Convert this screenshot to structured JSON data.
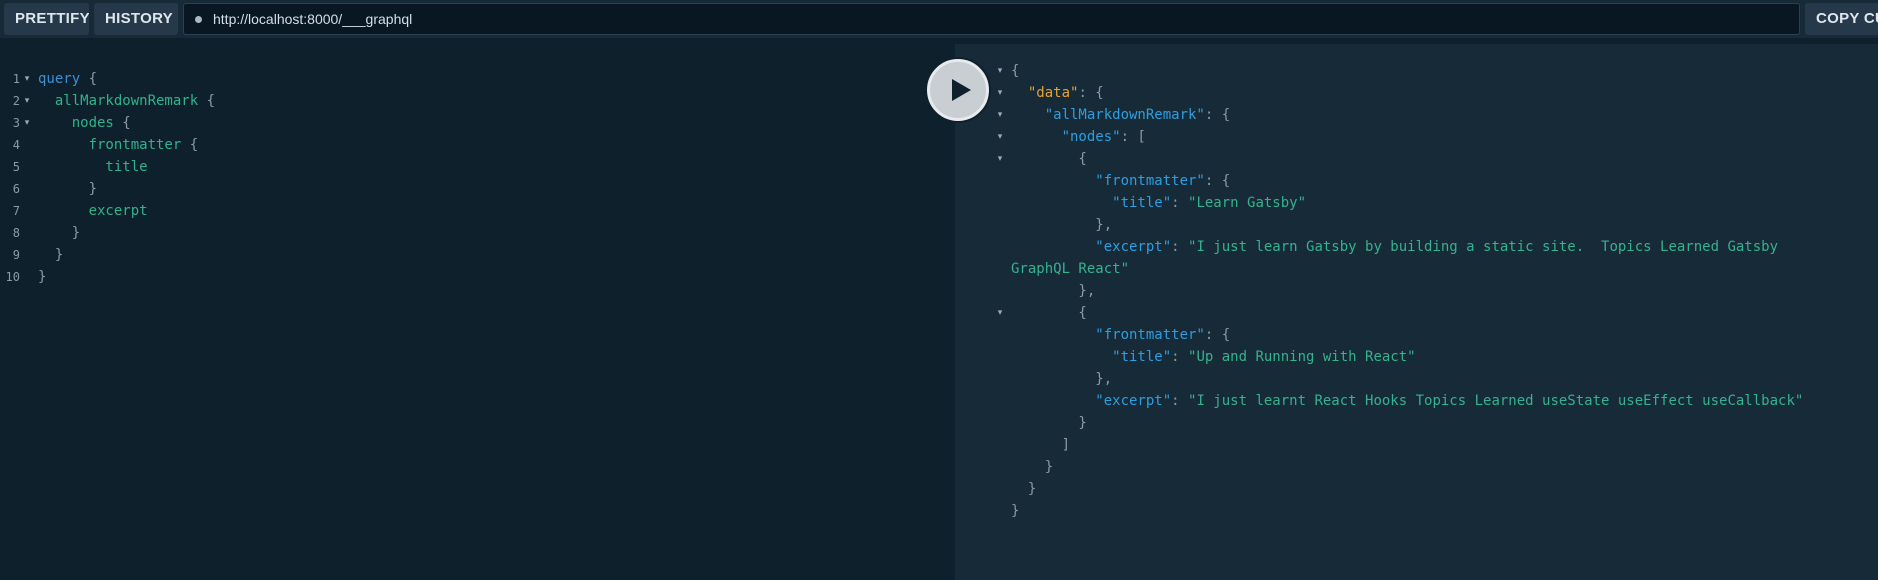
{
  "toolbar": {
    "prettify_label": "PRETTIFY",
    "history_label": "HISTORY",
    "url": "http://localhost:8000/___graphql",
    "copy_label": "COPY CU"
  },
  "run_button": {
    "icon": "play-icon"
  },
  "query_lines": [
    {
      "n": "1",
      "parts": [
        {
          "t": "query",
          "c": "kw"
        },
        {
          "t": " {",
          "c": "punc"
        }
      ]
    },
    {
      "n": "2",
      "parts": [
        {
          "t": "  allMarkdownRemark",
          "c": "field"
        },
        {
          "t": " {",
          "c": "punc"
        }
      ]
    },
    {
      "n": "3",
      "parts": [
        {
          "t": "    nodes",
          "c": "field"
        },
        {
          "t": " {",
          "c": "punc"
        }
      ]
    },
    {
      "n": "4",
      "parts": [
        {
          "t": "      frontmatter",
          "c": "field"
        },
        {
          "t": " {",
          "c": "punc"
        }
      ]
    },
    {
      "n": "5",
      "parts": [
        {
          "t": "        title",
          "c": "field"
        }
      ]
    },
    {
      "n": "6",
      "parts": [
        {
          "t": "      }",
          "c": "punc"
        }
      ]
    },
    {
      "n": "7",
      "parts": [
        {
          "t": "      excerpt",
          "c": "field"
        }
      ]
    },
    {
      "n": "8",
      "parts": [
        {
          "t": "    }",
          "c": "punc"
        }
      ]
    },
    {
      "n": "9",
      "parts": [
        {
          "t": "  }",
          "c": "punc"
        }
      ]
    },
    {
      "n": "10",
      "parts": [
        {
          "t": "}",
          "c": "punc"
        }
      ]
    }
  ],
  "result_lines": [
    {
      "parts": [
        {
          "t": "{",
          "c": "punc"
        }
      ]
    },
    {
      "parts": [
        {
          "t": "  \"data\"",
          "c": "dkey"
        },
        {
          "t": ": {",
          "c": "punc"
        }
      ]
    },
    {
      "parts": [
        {
          "t": "    \"allMarkdownRemark\"",
          "c": "key"
        },
        {
          "t": ": {",
          "c": "punc"
        }
      ]
    },
    {
      "parts": [
        {
          "t": "      \"nodes\"",
          "c": "key"
        },
        {
          "t": ": [",
          "c": "punc"
        }
      ]
    },
    {
      "parts": [
        {
          "t": "        {",
          "c": "punc"
        }
      ]
    },
    {
      "parts": [
        {
          "t": "          \"frontmatter\"",
          "c": "key"
        },
        {
          "t": ": {",
          "c": "punc"
        }
      ]
    },
    {
      "parts": [
        {
          "t": "            \"title\"",
          "c": "key"
        },
        {
          "t": ": ",
          "c": "punc"
        },
        {
          "t": "\"Learn Gatsby\"",
          "c": "str"
        }
      ]
    },
    {
      "parts": [
        {
          "t": "          },",
          "c": "punc"
        }
      ]
    },
    {
      "parts": [
        {
          "t": "          \"excerpt\"",
          "c": "key"
        },
        {
          "t": ": ",
          "c": "punc"
        },
        {
          "t": "\"I just learn Gatsby by building a static site.  Topics Learned Gatsby",
          "c": "str"
        }
      ]
    },
    {
      "parts": [
        {
          "t": "GraphQL React\"",
          "c": "str"
        }
      ]
    },
    {
      "parts": [
        {
          "t": "        },",
          "c": "punc"
        }
      ]
    },
    {
      "parts": [
        {
          "t": "        {",
          "c": "punc"
        }
      ]
    },
    {
      "parts": [
        {
          "t": "          \"frontmatter\"",
          "c": "key"
        },
        {
          "t": ": {",
          "c": "punc"
        }
      ]
    },
    {
      "parts": [
        {
          "t": "            \"title\"",
          "c": "key"
        },
        {
          "t": ": ",
          "c": "punc"
        },
        {
          "t": "\"Up and Running with React\"",
          "c": "str"
        }
      ]
    },
    {
      "parts": [
        {
          "t": "          },",
          "c": "punc"
        }
      ]
    },
    {
      "parts": [
        {
          "t": "          \"excerpt\"",
          "c": "key"
        },
        {
          "t": ": ",
          "c": "punc"
        },
        {
          "t": "\"I just learnt React Hooks Topics Learned useState useEffect useCallback\"",
          "c": "str"
        }
      ]
    },
    {
      "parts": [
        {
          "t": "        }",
          "c": "punc"
        }
      ]
    },
    {
      "parts": [
        {
          "t": "      ]",
          "c": "punc"
        }
      ]
    },
    {
      "parts": [
        {
          "t": "    }",
          "c": "punc"
        }
      ]
    },
    {
      "parts": [
        {
          "t": "  }",
          "c": "punc"
        }
      ]
    },
    {
      "parts": [
        {
          "t": "}",
          "c": "punc"
        }
      ]
    }
  ]
}
